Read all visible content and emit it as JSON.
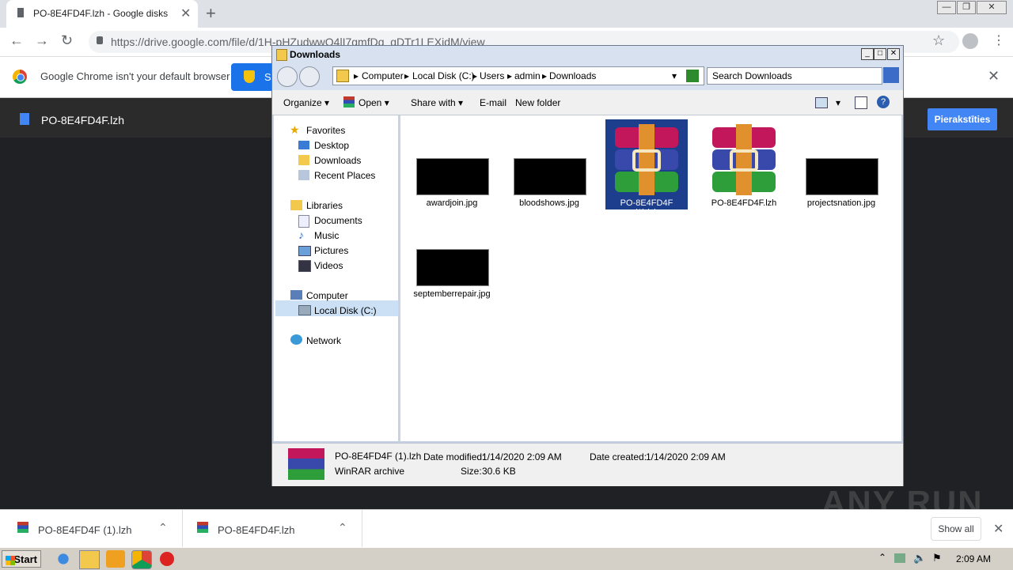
{
  "browser": {
    "tab_title": "PO-8E4FD4F.lzh - Google disks",
    "url": "https://drive.google.com/file/d/1H-pHZudwwO4lI7gmfDq_qDTr1LEXjdM/view",
    "infobar_text": "Google Chrome isn't your default browser",
    "infobar_button": "S"
  },
  "drive": {
    "file_name": "PO-8E4FD4F.lzh",
    "signin_label": "Pierakstīties"
  },
  "explorer": {
    "title": "Downloads",
    "breadcrumbs": [
      "Computer",
      "Local Disk (C:)",
      "Users",
      "admin",
      "Downloads"
    ],
    "search_placeholder": "Search Downloads",
    "commands": [
      "Organize",
      "Open",
      "Share with",
      "E-mail",
      "New folder"
    ],
    "nav": {
      "favorites": "Favorites",
      "desktop": "Desktop",
      "downloads": "Downloads",
      "recent": "Recent Places",
      "libraries": "Libraries",
      "documents": "Documents",
      "music": "Music",
      "pictures": "Pictures",
      "videos": "Videos",
      "computer": "Computer",
      "localdisk": "Local Disk (C:)",
      "network": "Network"
    },
    "files": [
      "awardjoin.jpg",
      "bloodshows.jpg",
      "PO-8E4FD4F (1).lzh",
      "PO-8E4FD4F.lzh",
      "projectsnation.jpg",
      "septemberrepair.jpg"
    ],
    "details": {
      "name": "PO-8E4FD4F (1).lzh",
      "type": "WinRAR archive",
      "modified_label": "Date modified:",
      "modified": "1/14/2020 2:09 AM",
      "created_label": "Date created:",
      "created": "1/14/2020 2:09 AM",
      "size_label": "Size:",
      "size": "30.6 KB"
    }
  },
  "downloads_bar": {
    "items": [
      "PO-8E4FD4F (1).lzh",
      "PO-8E4FD4F.lzh"
    ],
    "show_all": "Show all"
  },
  "taskbar": {
    "start": "Start",
    "clock": "2:09 AM"
  },
  "watermark": "ANY RUN"
}
